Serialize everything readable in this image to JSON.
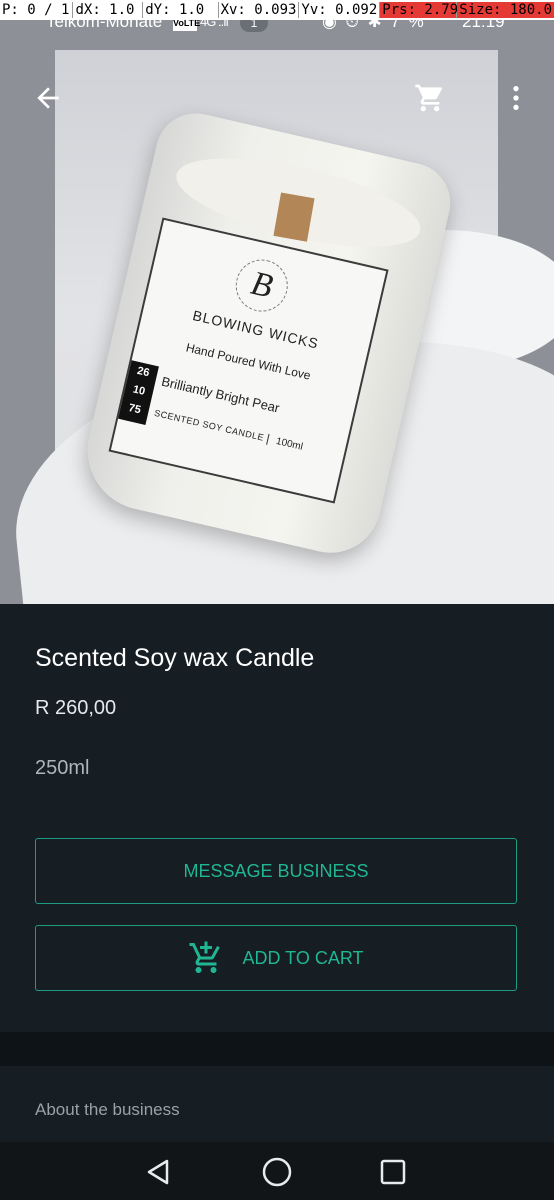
{
  "debug_overlay": {
    "pointer": "P: 0 / 1",
    "dx": "dX: 1.0",
    "dy": "dY: 1.0",
    "xv": "Xv: 0.093",
    "yv": "Yv: 0.092",
    "prs": "Prs: 2.79",
    "size": "Size: 180.0"
  },
  "status_bar": {
    "carrier": "Telkom-Monate",
    "volte": "VoLTE",
    "signal": "4G ..ıl",
    "notification_count": "1",
    "icons": "◉ ⏲ ✱ 7 %",
    "time": "21:19"
  },
  "toolbar": {
    "back_icon": "arrow-back",
    "cart_icon": "shopping-cart",
    "more_icon": "more-vertical"
  },
  "product_image": {
    "brand_logo": "B",
    "brand": "BLOWING WICKS",
    "tagline": "Hand Poured With Love",
    "numbers": [
      "26",
      "10",
      "75"
    ],
    "scent": "Brilliantly Bright Pear",
    "type": "SCENTED SOY CANDLE",
    "size": "100ml"
  },
  "product": {
    "title": "Scented Soy wax Candle",
    "price": "R 260,00",
    "description": "250ml"
  },
  "actions": {
    "message_label": "MESSAGE BUSINESS",
    "add_to_cart_label": "ADD TO CART",
    "accent_color": "#21b693"
  },
  "about": {
    "label": "About the business"
  },
  "nav_bar": {
    "back": "triangle-back",
    "home": "circle-home",
    "recent": "square-recents"
  }
}
